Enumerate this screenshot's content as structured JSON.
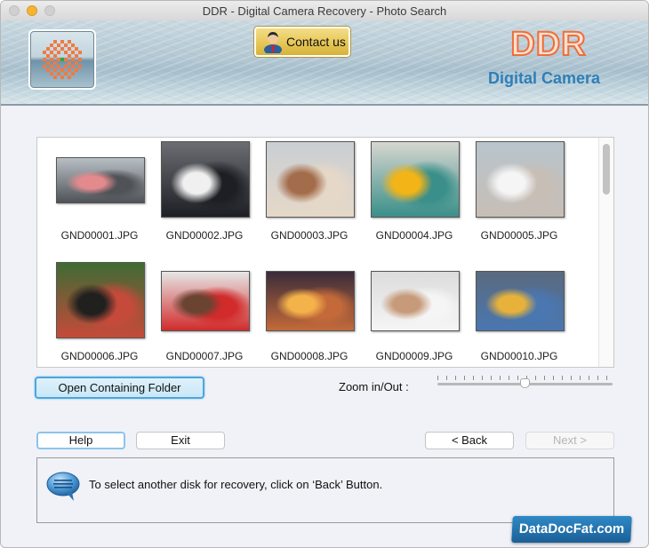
{
  "window": {
    "title": "DDR - Digital Camera Recovery - Photo Search"
  },
  "banner": {
    "contact_label": "Contact us",
    "brand_title": "DDR",
    "brand_subtitle": "Digital Camera"
  },
  "gallery": {
    "items": [
      {
        "filename": "GND00001.JPG",
        "thumb_colors": [
          "#b8bfc4",
          "#4f5358",
          "#e38a8d"
        ]
      },
      {
        "filename": "GND00002.JPG",
        "thumb_colors": [
          "#6b6d72",
          "#1e1f24",
          "#f0f0f0"
        ]
      },
      {
        "filename": "GND00003.JPG",
        "thumb_colors": [
          "#c9cfd3",
          "#e6d8c8",
          "#a36c4a"
        ]
      },
      {
        "filename": "GND00004.JPG",
        "thumb_colors": [
          "#d7d6d0",
          "#3a8f8a",
          "#f2b417"
        ]
      },
      {
        "filename": "GND00005.JPG",
        "thumb_colors": [
          "#b8c4cc",
          "#c7beb6",
          "#f5f5f5"
        ]
      },
      {
        "filename": "GND00006.JPG",
        "thumb_colors": [
          "#3e6b34",
          "#c64a3a",
          "#20201f"
        ]
      },
      {
        "filename": "GND00007.JPG",
        "thumb_colors": [
          "#e6e6e6",
          "#d22b2b",
          "#6b4331"
        ]
      },
      {
        "filename": "GND00008.JPG",
        "thumb_colors": [
          "#3a2c3a",
          "#c46a3a",
          "#f4b24a"
        ]
      },
      {
        "filename": "GND00009.JPG",
        "thumb_colors": [
          "#dcdcdc",
          "#f5f5f5",
          "#c69a7a"
        ]
      },
      {
        "filename": "GND00010.JPG",
        "thumb_colors": [
          "#5a6a80",
          "#4a77b0",
          "#e8b23a"
        ]
      }
    ]
  },
  "controls": {
    "open_folder_label": "Open Containing Folder",
    "zoom_label": "Zoom in/Out :",
    "zoom_value_percent": 50
  },
  "footer": {
    "help_label": "Help",
    "exit_label": "Exit",
    "back_label": "< Back",
    "next_label": "Next >",
    "message": "To select another disk for recovery, click on ‘Back’ Button."
  },
  "watermark": "DataDocFat.com"
}
